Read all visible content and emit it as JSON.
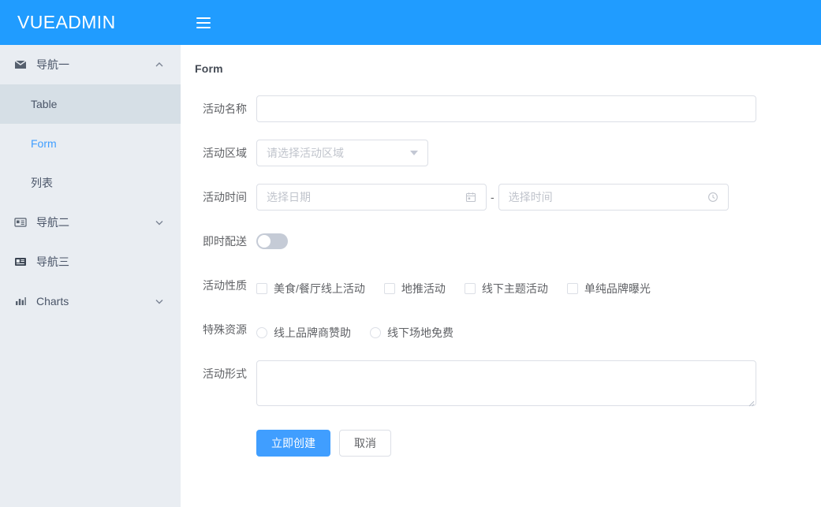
{
  "brand": {
    "title": "VUEADMIN"
  },
  "sidebar": {
    "groups": [
      {
        "label": "导航一",
        "icon": "message-icon",
        "chevron": "chevron-up-icon",
        "expanded": true,
        "items": [
          {
            "label": "Table",
            "state": "hover"
          },
          {
            "label": "Form",
            "state": "active"
          },
          {
            "label": "列表",
            "state": "normal"
          }
        ]
      },
      {
        "label": "导航二",
        "icon": "id-card-icon",
        "chevron": "chevron-down-icon",
        "expanded": false,
        "items": []
      },
      {
        "label": "导航三",
        "icon": "postcard-icon",
        "chevron": "",
        "expanded": false,
        "items": []
      },
      {
        "label": "Charts",
        "icon": "bar-chart-icon",
        "chevron": "chevron-down-icon",
        "expanded": false,
        "items": []
      }
    ]
  },
  "topbar": {
    "menu_toggle": "hamburger-icon"
  },
  "main": {
    "page_title": "Form",
    "fields": {
      "activity_name": {
        "label": "活动名称",
        "value": "",
        "placeholder": ""
      },
      "activity_zone": {
        "label": "活动区域",
        "value": "",
        "placeholder": "请选择活动区域",
        "options": []
      },
      "activity_time": {
        "label": "活动时间",
        "date_placeholder": "选择日期",
        "date_value": "",
        "time_placeholder": "选择时间",
        "time_value": "",
        "separator": "-"
      },
      "instant_delivery": {
        "label": "即时配送",
        "checked": false
      },
      "activity_nature": {
        "label": "活动性质",
        "options": [
          {
            "label": "美食/餐厅线上活动",
            "checked": false
          },
          {
            "label": "地推活动",
            "checked": false
          },
          {
            "label": "线下主题活动",
            "checked": false
          },
          {
            "label": "单纯品牌曝光",
            "checked": false
          }
        ]
      },
      "special_resource": {
        "label": "特殊资源",
        "options": [
          {
            "label": "线上品牌商赞助",
            "checked": false
          },
          {
            "label": "线下场地免费",
            "checked": false
          }
        ]
      },
      "activity_form": {
        "label": "活动形式",
        "value": "",
        "placeholder": ""
      }
    },
    "actions": {
      "submit_label": "立即创建",
      "cancel_label": "取消"
    }
  },
  "colors": {
    "brand_blue": "#209cff",
    "primary": "#409eff",
    "sidebar_bg": "#e9edf2",
    "sidebar_hover": "#d6dfe6",
    "border": "#dcdfe6",
    "placeholder": "#c0c4cc",
    "text": "#606266"
  }
}
